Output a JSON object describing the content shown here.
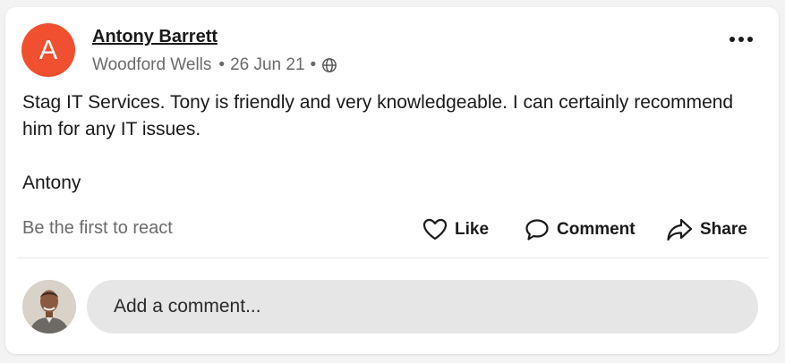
{
  "colors": {
    "avatar_bg": "#f0502f",
    "card_bg": "#ffffff",
    "muted_text": "#6b6b6b",
    "input_bg": "#e6e6e6"
  },
  "post": {
    "avatar_letter": "A",
    "author": "Antony Barrett",
    "location": "Woodford Wells",
    "date": "26 Jun 21",
    "separator": "•",
    "visibility_icon": "globe-icon",
    "more_icon": "more-dots-icon",
    "body": "Stag IT Services. Tony is friendly  and very knowledgeable. I can certainly recommend him for any IT issues.",
    "signature": "Antony"
  },
  "reactions": {
    "summary": "Be the first to react"
  },
  "actions": {
    "like_label": "Like",
    "like_icon": "heart-icon",
    "comment_label": "Comment",
    "comment_icon": "speech-bubble-icon",
    "share_label": "Share",
    "share_icon": "share-arrow-icon"
  },
  "comment_box": {
    "placeholder": "Add a comment...",
    "user_avatar_icon": "user-photo-avatar"
  }
}
